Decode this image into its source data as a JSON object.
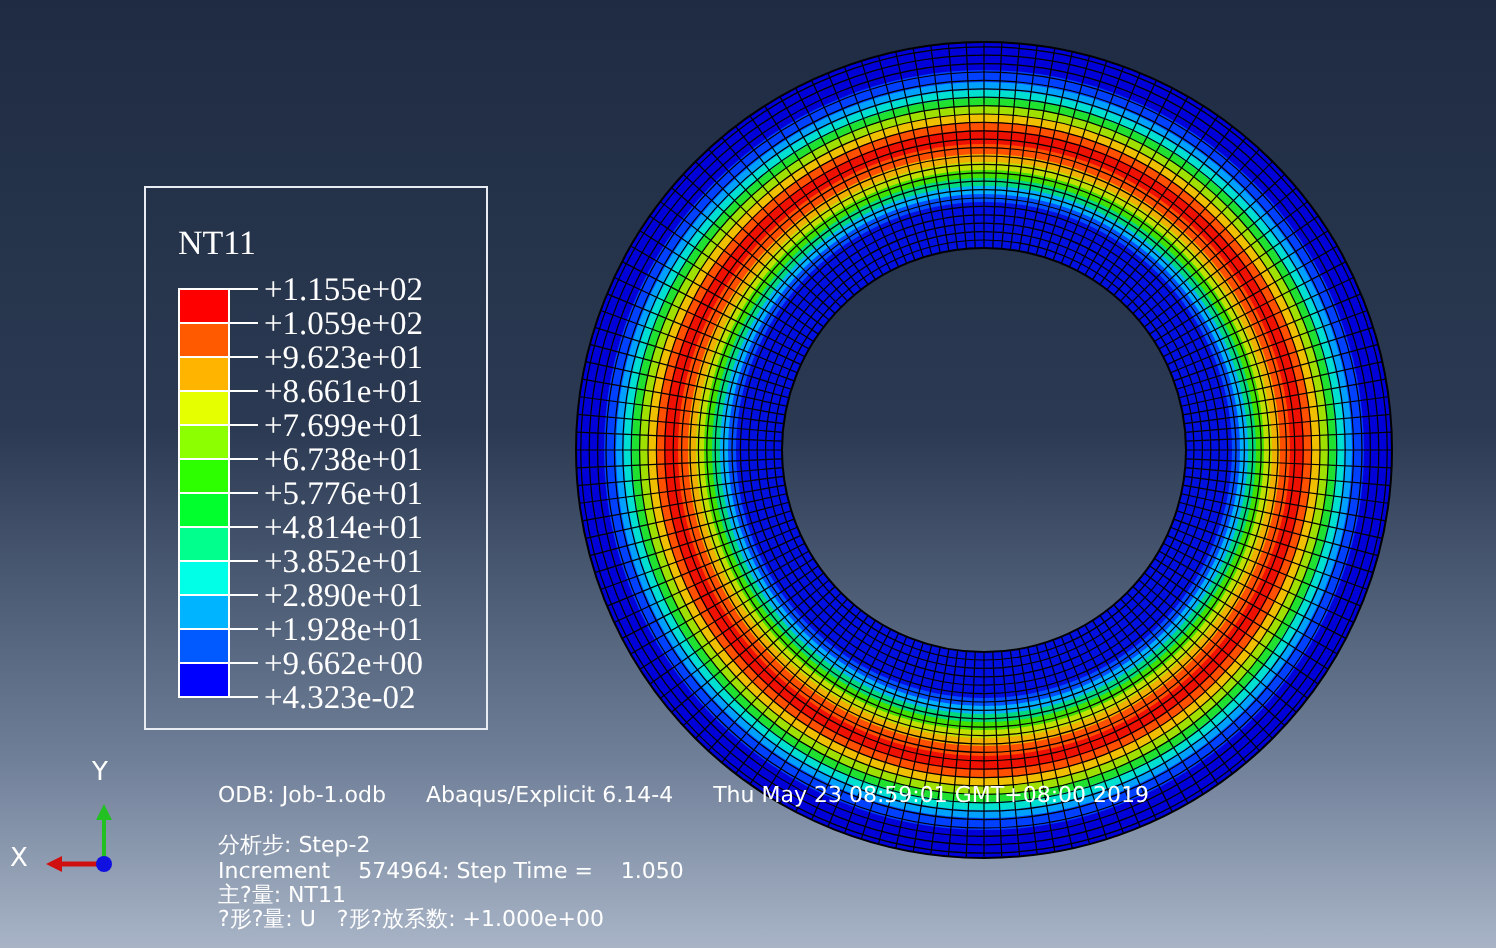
{
  "legend": {
    "title": "NT11",
    "labels": [
      "+1.155e+02",
      "+1.059e+02",
      "+9.623e+01",
      "+8.661e+01",
      "+7.699e+01",
      "+6.738e+01",
      "+5.776e+01",
      "+4.814e+01",
      "+3.852e+01",
      "+2.890e+01",
      "+1.928e+01",
      "+9.662e+00",
      "+4.323e-02"
    ],
    "bands": [
      {
        "color": "#ff0000"
      },
      {
        "color": "#ff5a00"
      },
      {
        "color": "#ffb400"
      },
      {
        "color": "#e6ff00"
      },
      {
        "color": "#8cff00"
      },
      {
        "color": "#2dff00"
      },
      {
        "color": "#00ff2d"
      },
      {
        "color": "#00ff8c"
      },
      {
        "color": "#00ffe6"
      },
      {
        "color": "#00b4ff"
      },
      {
        "color": "#005aff"
      },
      {
        "color": "#0000ff"
      }
    ]
  },
  "triad": {
    "y_label": "Y",
    "x_label": "X"
  },
  "info": {
    "odb": "ODB: Job-1.odb",
    "solver": "Abaqus/Explicit 6.14-4",
    "date": "Thu May 23 08:59:01 GMT+08:00 2019",
    "lines": [
      "分析步: Step-2",
      "Increment    574964: Step Time =    1.050",
      "主?量: NT11",
      "?形?量: U   ?形?放系数: +1.000e+00"
    ]
  }
}
